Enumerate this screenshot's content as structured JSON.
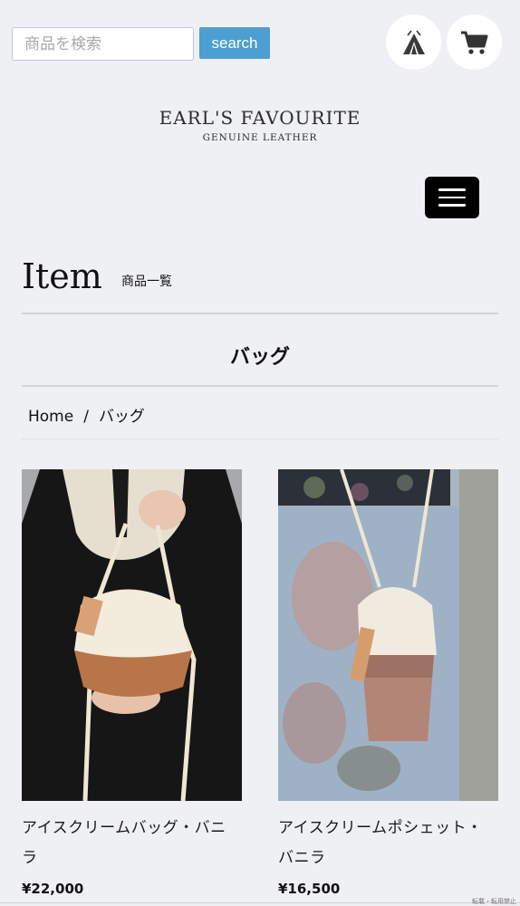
{
  "header": {
    "search_placeholder": "商品を検索",
    "search_button": "search",
    "tent_icon": "tent-icon",
    "cart_icon": "cart-icon"
  },
  "logo": {
    "main": "EARL'S FAVOURITE",
    "sub": "GENUINE LEATHER"
  },
  "menu_icon": "hamburger-icon",
  "section": {
    "title": "Item",
    "subtitle": "商品一覧"
  },
  "category": {
    "title": "バッグ"
  },
  "breadcrumb": {
    "home": "Home",
    "separator": "/",
    "current": "バッグ"
  },
  "products": [
    {
      "name": "アイスクリームバッグ・バニラ",
      "price": "¥22,000"
    },
    {
      "name": "アイスクリームポシェット・バニラ",
      "price": "¥16,500"
    }
  ],
  "footer_note": "転載・転用禁止",
  "colors": {
    "background": "#eff0f4",
    "search_button": "#4d9fd1",
    "menu_button": "#000000"
  }
}
